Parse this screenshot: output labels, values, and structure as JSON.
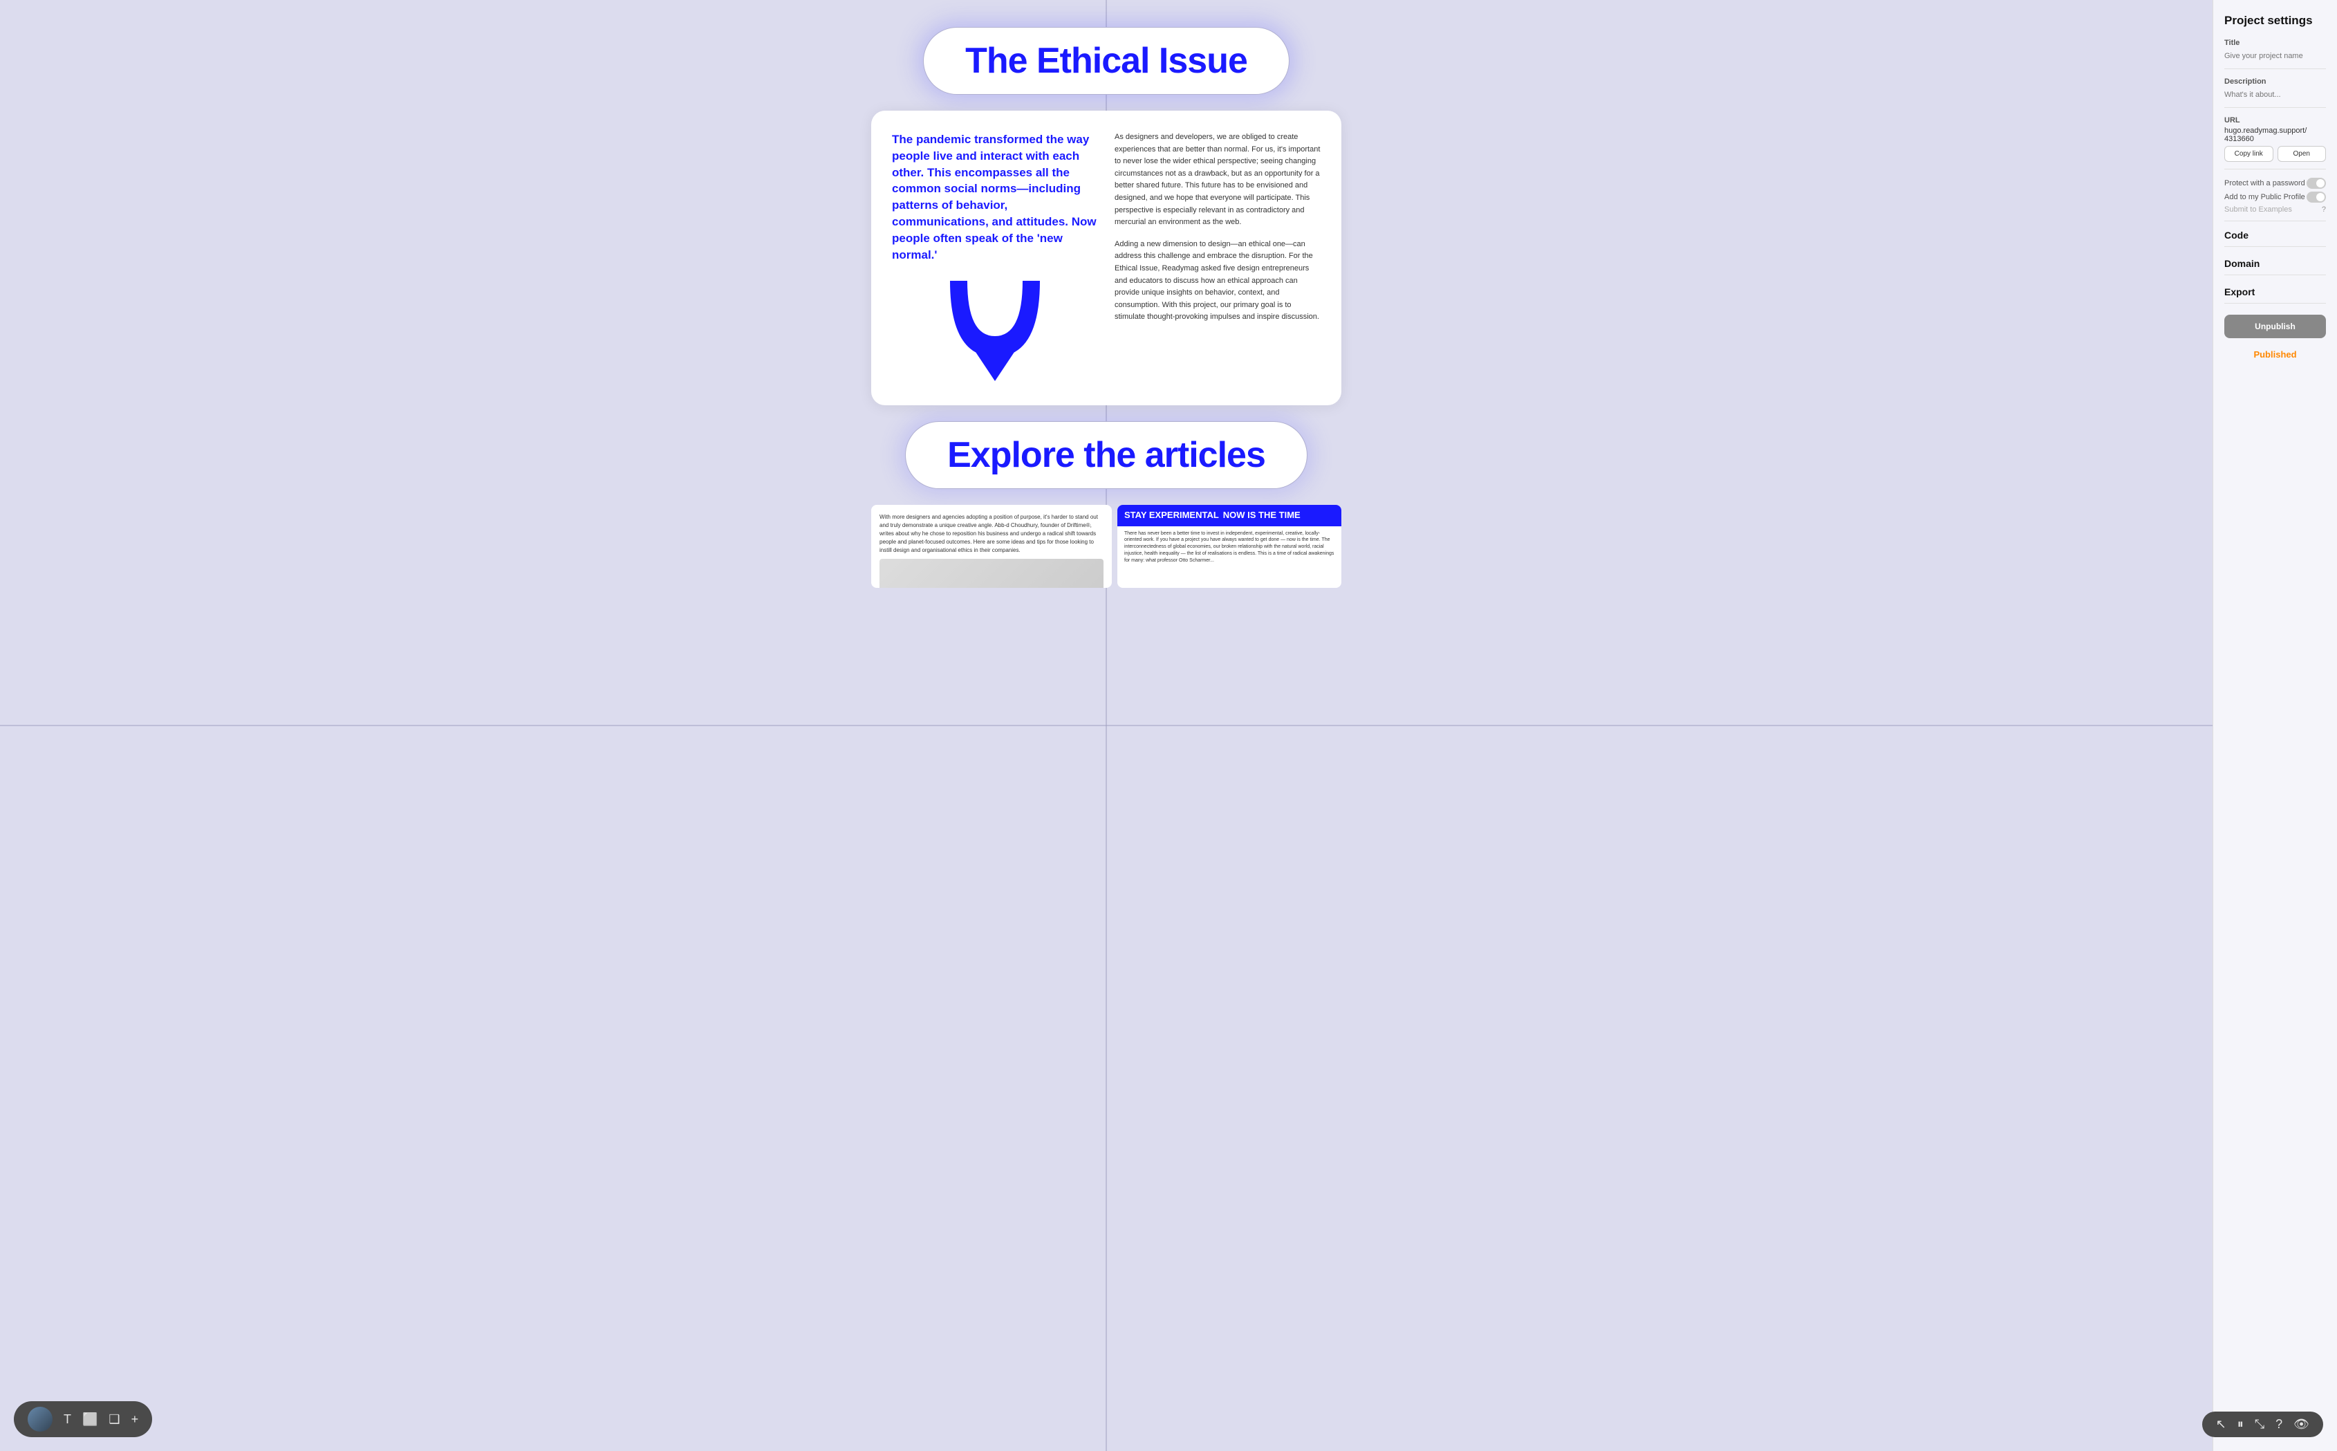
{
  "panel": {
    "title": "Project settings",
    "title_field": {
      "label": "Title",
      "placeholder": "Give your project name"
    },
    "description_field": {
      "label": "Description",
      "placeholder": "What's it about..."
    },
    "url_field": {
      "label": "URL",
      "value": "hugo.readymag.support/\n4313660"
    },
    "copy_btn": "Copy link",
    "open_btn": "Open",
    "protect_label": "Protect with a password",
    "profile_label": "Add to my Public Profile",
    "submit_label": "Submit to Examples",
    "code_label": "Code",
    "domain_label": "Domain",
    "export_label": "Export",
    "unpublish_btn": "Unpublish",
    "published_label": "Published"
  },
  "canvas": {
    "title": "The Ethical Issue",
    "explore": "Explore the articles",
    "left_heading": "The pandemic transformed the way people live and interact with each other. This encompasses all the common social norms—including patterns of behavior, communications, and attitudes. Now people often speak of the 'new normal.'",
    "right_para1": "As designers and developers, we are obliged to create experiences that are better than normal. For us, it's important to never lose the wider ethical perspective; seeing changing circumstances not as a drawback, but as an opportunity for a better shared future. This future has to be envisioned and designed, and we hope that everyone will participate. This perspective is especially relevant in as contradictory and mercurial an environment as the web.",
    "right_para2": "Adding a new dimension to design—an ethical one—can address this challenge and embrace the disruption. For the Ethical Issue, Readymag asked five design entrepreneurs and educators to discuss how an ethical approach can provide unique insights on behavior, context, and consumption. With this project, our primary goal is to stimulate thought-provoking impulses and inspire discussion.",
    "preview_text": "With more designers and agencies adopting a position of purpose, it's harder to stand out and truly demonstrate a unique creative angle. Abb-d Choudhury, founder of Driftime®, writes about why he chose to reposition his business and undergo a radical shift towards people and planet-focused outcomes. Here are some ideas and tips for those looking to instill design and organisational ethics in their companies.",
    "stay_experimental": "STAY EXPERIMENTAL",
    "now_is_the_time": "NOW IS THE TIME",
    "preview_right_text": "There has never been a better time to invest in independent, experimental, creative, locally-oriented work. If you have a project you have always wanted to get done — now is the time. The interconnectedness of global economies, our broken relationship with the natural world, racial injustice, health inequality — the list of realisations is endless. This is a time of radical awakenings for many: what professor Otto Scharmer..."
  },
  "toolbar_left": {
    "tools": [
      "T",
      "⬜",
      "⬚",
      "+"
    ]
  },
  "toolbar_right": {
    "tools": [
      "↖",
      "⏸",
      "⤡",
      "?",
      "👁"
    ]
  }
}
